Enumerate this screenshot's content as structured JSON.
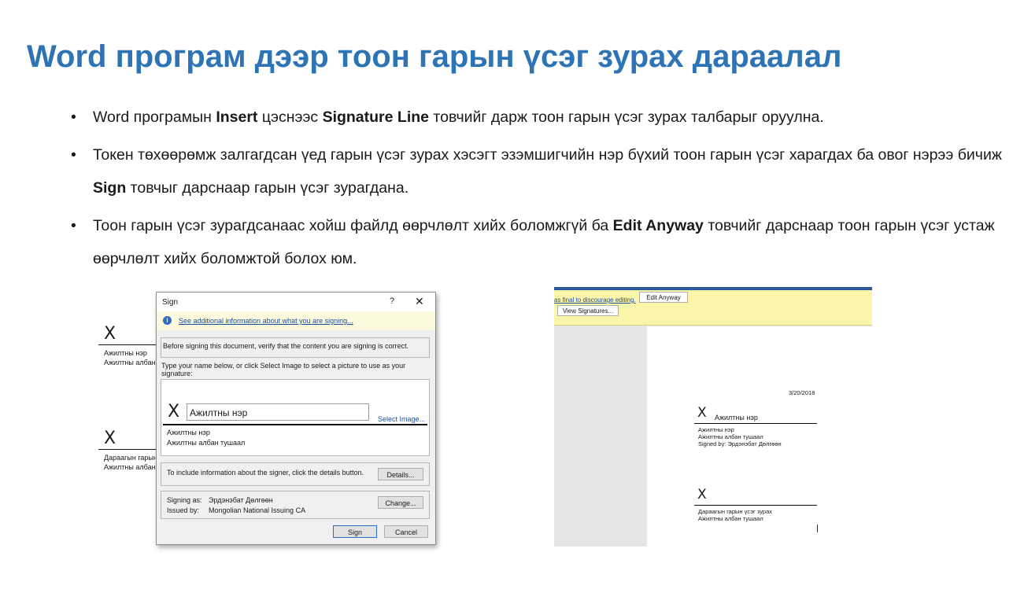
{
  "title": "Word програм дээр тоон гарын үсэг зурах дараалал",
  "bullets": [
    {
      "p1": "Word програмын ",
      "b1": "Insert",
      "p2": " цэснээс ",
      "b2": "Signature Line",
      "p3": " товчийг дарж тоон гарын үсэг зурах талбарыг оруулна."
    },
    {
      "p1": "Токен төхөөрөмж залгагдсан үед гарын үсэг зурах хэсэгт эзэмшигчийн нэр бүхий тоон гарын үсэг харагдах ба овог нэрээ бичиж ",
      "b1": "Sign",
      "p2": " товчыг дарснаар гарын үсэг зурагдана."
    },
    {
      "p1": "Тоон гарын үсэг зурагдсанаас хойш файлд өөрчлөлт хийх боломжгүй ба ",
      "b1": "Edit Anyway",
      "p2": " товчийг дарснаар тоон гарын үсэг устаж өөрчлөлт хийх боломжтой болох юм."
    }
  ],
  "left_doc": {
    "x1": "X",
    "name1": "Ажилтны нэр",
    "pos1": "Ажилтны албан",
    "x2": "X",
    "name2": "Дараагын гарын",
    "pos2": "Ажилтны албан"
  },
  "dialog": {
    "title": "Sign",
    "help": "?",
    "close": "✕",
    "info_link": "See additional information about what you are signing...",
    "verify_text": "Before signing this document, verify that the content you are signing is correct.",
    "type_text_1": "Type your name below, or click Select Image to select a picture to use as your",
    "type_text_2": "signature:",
    "x": "X",
    "name_value": "Ажилтны нэр",
    "select_image": "Select Image...",
    "signer_name": "Ажилтны нэр",
    "signer_position": "Ажилтны албан тушаал",
    "details_text": "To include information about the signer, click the details button.",
    "details_button": "Details...",
    "signing_as_label": "Signing as:",
    "signing_as_value": "Эрдэнэбат Дөлгөөн",
    "issued_by_label": "Issued by:",
    "issued_by_value": "Mongolian National Issuing CA",
    "change_button": "Change...",
    "sign_button": "Sign",
    "cancel_button": "Cancel"
  },
  "word_view": {
    "bar_link": "as final to discourage editing.",
    "edit_anyway": "Edit Anyway",
    "view_signatures": "View Signatures...",
    "date": "3/20/2018",
    "x1": "X",
    "name1": "Ажилтны нэр",
    "sub_name1": "Ажилтны нэр",
    "sub_pos1": "Ажилтны албан тушаал",
    "signed_by": "Signed by: Эрдэнэбат Дөлгөөн",
    "x2": "X",
    "name2": "Дараагын гарын үсэг зурах",
    "pos2": "Ажилтны албан тушаал"
  }
}
